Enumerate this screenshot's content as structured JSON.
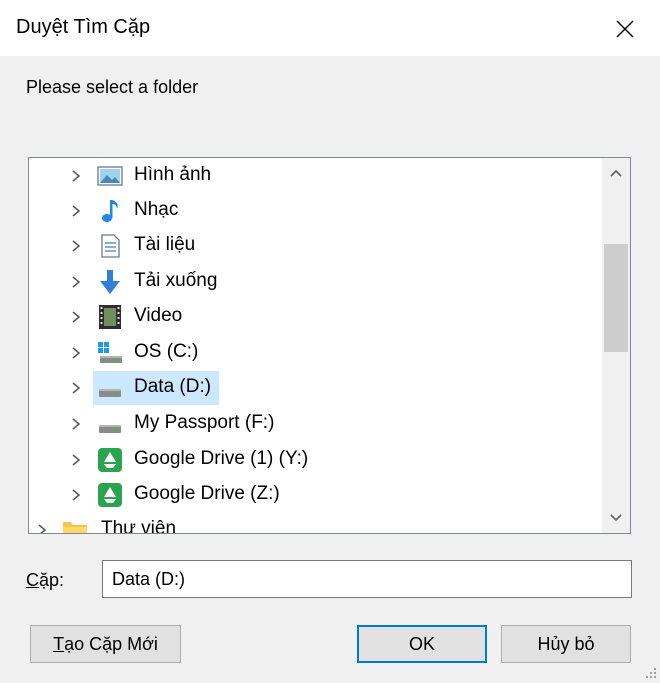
{
  "window": {
    "title": "Duyệt Tìm Cặp"
  },
  "instruction": "Please select a folder",
  "tree": {
    "items": [
      {
        "label": "Hình ảnh",
        "icon": "pictures-icon"
      },
      {
        "label": "Nhạc",
        "icon": "music-icon"
      },
      {
        "label": "Tài liệu",
        "icon": "documents-icon"
      },
      {
        "label": "Tải xuống",
        "icon": "downloads-icon"
      },
      {
        "label": "Video",
        "icon": "video-icon"
      },
      {
        "label": "OS (C:)",
        "icon": "windows-drive-icon"
      },
      {
        "label": "Data (D:)",
        "icon": "drive-icon",
        "selected": true
      },
      {
        "label": "My Passport (F:)",
        "icon": "drive-icon"
      },
      {
        "label": "Google Drive (1) (Y:)",
        "icon": "google-drive-icon"
      },
      {
        "label": "Google Drive (Z:)",
        "icon": "google-drive-icon"
      },
      {
        "label": "Thư viện",
        "icon": "library-folder-icon"
      }
    ]
  },
  "folder": {
    "label_prefix": "C",
    "label_rest": "ặp:",
    "value": "Data (D:)"
  },
  "buttons": {
    "new_folder_prefix": "T",
    "new_folder_rest": "ạo Cặp Mới",
    "ok": "OK",
    "cancel": "Hủy bỏ"
  },
  "colors": {
    "selection": "#cce8ff",
    "accent": "#0078d7"
  }
}
